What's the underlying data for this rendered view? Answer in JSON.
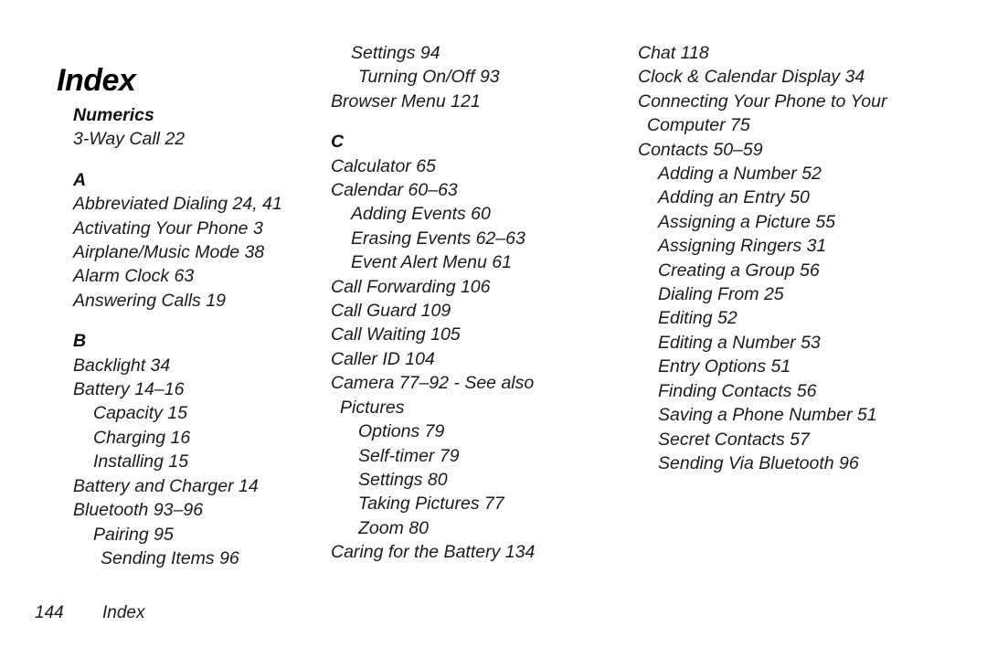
{
  "document": {
    "title": "Index",
    "footer": {
      "page_number": "144",
      "label": "Index"
    }
  },
  "columns": [
    {
      "id": "column-1",
      "blocks": [
        {
          "kind": "section",
          "label": "Numerics",
          "first": true
        },
        {
          "kind": "entry",
          "level": 0,
          "text": "3-Way Call  22"
        },
        {
          "kind": "section",
          "label": "A"
        },
        {
          "kind": "entry",
          "level": 0,
          "text": "Abbreviated Dialing  24, 41"
        },
        {
          "kind": "entry",
          "level": 0,
          "text": "Activating Your Phone  3"
        },
        {
          "kind": "entry",
          "level": 0,
          "text": "Airplane/Music Mode  38"
        },
        {
          "kind": "entry",
          "level": 0,
          "text": "Alarm Clock  63"
        },
        {
          "kind": "entry",
          "level": 0,
          "text": "Answering Calls  19"
        },
        {
          "kind": "section",
          "label": "B"
        },
        {
          "kind": "entry",
          "level": 0,
          "text": "Backlight  34"
        },
        {
          "kind": "entry",
          "level": 0,
          "text": "Battery  14–16"
        },
        {
          "kind": "entry",
          "level": 1,
          "text": "Capacity  15"
        },
        {
          "kind": "entry",
          "level": 1,
          "text": "Charging  16"
        },
        {
          "kind": "entry",
          "level": 1,
          "text": "Installing  15"
        },
        {
          "kind": "entry",
          "level": 0,
          "text": "Battery and Charger  14"
        },
        {
          "kind": "entry",
          "level": 0,
          "text": "Bluetooth  93–96"
        },
        {
          "kind": "entry",
          "level": 1,
          "text": "Pairing  95"
        },
        {
          "kind": "entry",
          "level": 2,
          "text": "Sending Items 96"
        }
      ]
    },
    {
      "id": "column-2",
      "blocks": [
        {
          "kind": "entry",
          "level": 1,
          "text": "Settings  94"
        },
        {
          "kind": "entry",
          "level": 2,
          "text": "Turning On/Off  93"
        },
        {
          "kind": "entry",
          "level": 0,
          "text": "Browser Menu  121"
        },
        {
          "kind": "section",
          "label": "C"
        },
        {
          "kind": "entry",
          "level": 0,
          "text": "Calculator  65"
        },
        {
          "kind": "entry",
          "level": 0,
          "text": "Calendar  60–63"
        },
        {
          "kind": "entry",
          "level": 1,
          "text": "Adding Events  60"
        },
        {
          "kind": "entry",
          "level": 1,
          "text": "Erasing Events  62–63"
        },
        {
          "kind": "entry",
          "level": 1,
          "text": "Event Alert Menu  61"
        },
        {
          "kind": "entry",
          "level": 0,
          "text": "Call Forwarding  106"
        },
        {
          "kind": "entry",
          "level": 0,
          "text": "Call Guard  109"
        },
        {
          "kind": "entry",
          "level": 0,
          "text": "Call Waiting  105"
        },
        {
          "kind": "entry",
          "level": 0,
          "text": "Caller ID  104"
        },
        {
          "kind": "entry",
          "level": 0,
          "text": "Camera  77–92 - See also"
        },
        {
          "kind": "entry",
          "level": "w",
          "text": "Pictures"
        },
        {
          "kind": "entry",
          "level": 2,
          "text": "Options  79"
        },
        {
          "kind": "entry",
          "level": 2,
          "text": "Self-timer  79"
        },
        {
          "kind": "entry",
          "level": 2,
          "text": "Settings  80"
        },
        {
          "kind": "entry",
          "level": 2,
          "text": "Taking Pictures  77"
        },
        {
          "kind": "entry",
          "level": 2,
          "text": "Zoom  80"
        },
        {
          "kind": "entry",
          "level": 0,
          "text": "Caring for the Battery  134"
        }
      ]
    },
    {
      "id": "column-3",
      "blocks": [
        {
          "kind": "entry",
          "level": 0,
          "text": "Chat  118"
        },
        {
          "kind": "entry",
          "level": 0,
          "text": "Clock & Calendar Display  34"
        },
        {
          "kind": "entry",
          "level": 0,
          "text": "Connecting Your Phone to Your"
        },
        {
          "kind": "entry",
          "level": "w",
          "text": "Computer  75"
        },
        {
          "kind": "entry",
          "level": 0,
          "text": "Contacts  50–59"
        },
        {
          "kind": "entry",
          "level": 1,
          "text": "Adding a Number 52"
        },
        {
          "kind": "entry",
          "level": 1,
          "text": "Adding an Entry  50"
        },
        {
          "kind": "entry",
          "level": 1,
          "text": "Assigning a Picture  55"
        },
        {
          "kind": "entry",
          "level": 1,
          "text": "Assigning Ringers  31"
        },
        {
          "kind": "entry",
          "level": 1,
          "text": "Creating a Group  56"
        },
        {
          "kind": "entry",
          "level": 1,
          "text": "Dialing From  25"
        },
        {
          "kind": "entry",
          "level": 1,
          "text": "Editing  52"
        },
        {
          "kind": "entry",
          "level": 1,
          "text": "Editing a Number 53"
        },
        {
          "kind": "entry",
          "level": 1,
          "text": "Entry Options  51"
        },
        {
          "kind": "entry",
          "level": 1,
          "text": "Finding Contacts  56"
        },
        {
          "kind": "entry",
          "level": 1,
          "text": "Saving a Phone Number 51"
        },
        {
          "kind": "entry",
          "level": 1,
          "text": "Secret Contacts  57"
        },
        {
          "kind": "entry",
          "level": 1,
          "text": "Sending Via Bluetooth  96"
        }
      ]
    }
  ]
}
